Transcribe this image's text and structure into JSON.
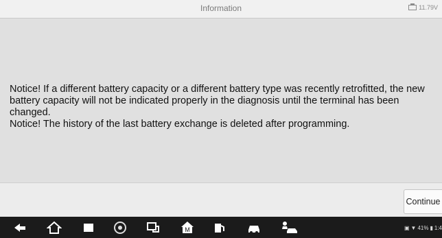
{
  "header": {
    "title": "Information",
    "voltage": "11.79V"
  },
  "main": {
    "notice_text": "Notice! If a different battery capacity or a different battery type was recently retrofitted, the new battery capacity will not be indicated properly in the diagnosis until the terminal has been changed.\n Notice! The history of the last battery exchange is deleted after programming."
  },
  "actions": {
    "continue_label": "Continue"
  },
  "navbar": {
    "icons": [
      "back-icon",
      "home-icon",
      "recent-apps-icon",
      "chrome-icon",
      "vci-icon",
      "maxifix-icon",
      "shop-icon",
      "car-icon",
      "people-car-icon"
    ],
    "status_battery": "41%",
    "status_time": "1:4"
  },
  "colors": {
    "navbar_bg": "#1b1b1b",
    "content_bg": "#e0e0e0"
  }
}
